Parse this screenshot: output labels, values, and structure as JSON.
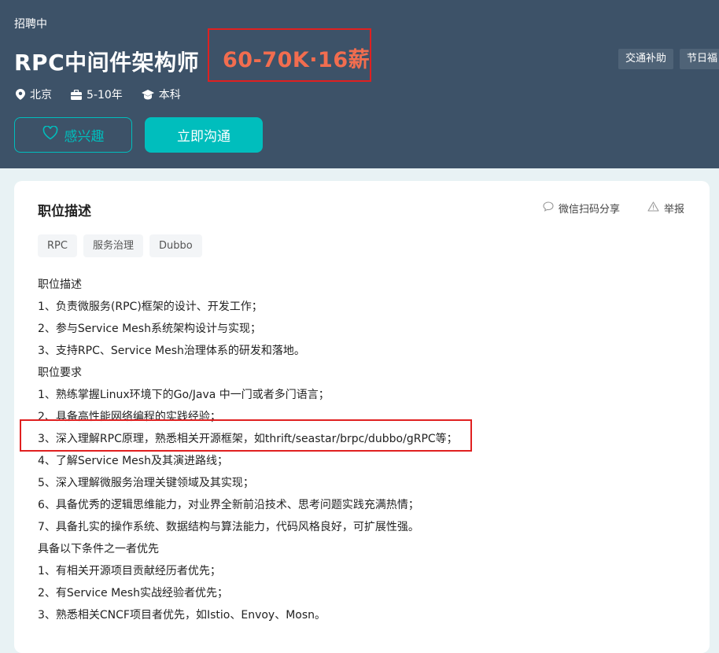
{
  "header": {
    "status": "招聘中",
    "title": "RPC中间件架构师",
    "salary": "60-70K·16薪",
    "benefits": [
      "交通补助",
      "节日福"
    ],
    "meta": {
      "city": "北京",
      "experience": "5-10年",
      "degree": "本科"
    },
    "buttons": {
      "interest": "感兴趣",
      "chat": "立即沟通"
    }
  },
  "card": {
    "section_title": "职位描述",
    "share_label": "微信扫码分享",
    "report_label": "举报",
    "tags": [
      "RPC",
      "服务治理",
      "Dubbo"
    ],
    "description": [
      "职位描述",
      "1、负责微服务(RPC)框架的设计、开发工作；",
      "2、参与Service Mesh系统架构设计与实现；",
      "3、支持RPC、Service Mesh治理体系的研发和落地。",
      "职位要求",
      "1、熟练掌握Linux环境下的Go/Java 中一门或者多门语言；",
      "2、具备高性能网络编程的实践经验；",
      "3、深入理解RPC原理，熟悉相关开源框架，如thrift/seastar/brpc/dubbo/gRPC等；",
      "4、了解Service Mesh及其演进路线；",
      "5、深入理解微服务治理关键领域及其实现；",
      "6、具备优秀的逻辑思维能力，对业界全新前沿技术、思考问题实践充满热情；",
      "7、具备扎实的操作系统、数据结构与算法能力，代码风格良好，可扩展性强。",
      "具备以下条件之一者优先",
      "1、有相关开源项目贡献经历者优先；",
      "2、有Service Mesh实战经验者优先；",
      "3、熟悉相关CNCF项目者优先，如Istio、Envoy、Mosn。"
    ]
  },
  "colors": {
    "header_bg": "#3d5268",
    "accent": "#00bebd",
    "salary": "#f26d4f",
    "highlight_border": "#e02020"
  }
}
